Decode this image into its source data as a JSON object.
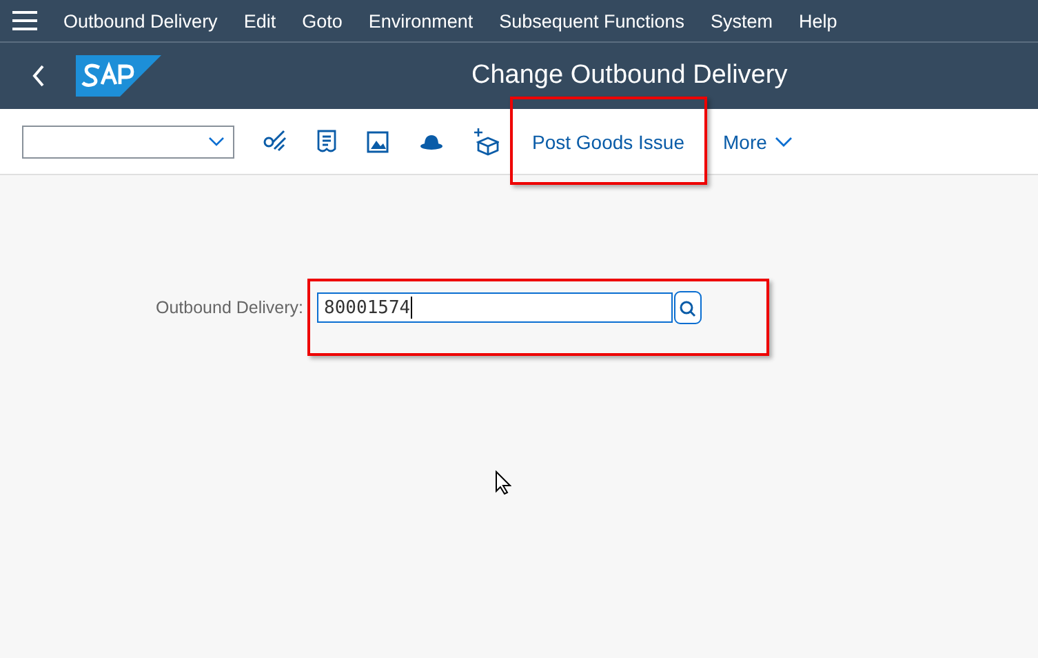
{
  "menu_bar": {
    "items": [
      "Outbound Delivery",
      "Edit",
      "Goto",
      "Environment",
      "Subsequent Functions",
      "System",
      "Help"
    ]
  },
  "header": {
    "title": "Change Outbound Delivery"
  },
  "toolbar": {
    "post_goods_issue": {
      "label": "Post Goods Issue",
      "highlighted": true
    },
    "more": {
      "label": "More"
    }
  },
  "form": {
    "label": "Outbound Delivery:",
    "value": "80001574",
    "highlighted": true
  }
}
